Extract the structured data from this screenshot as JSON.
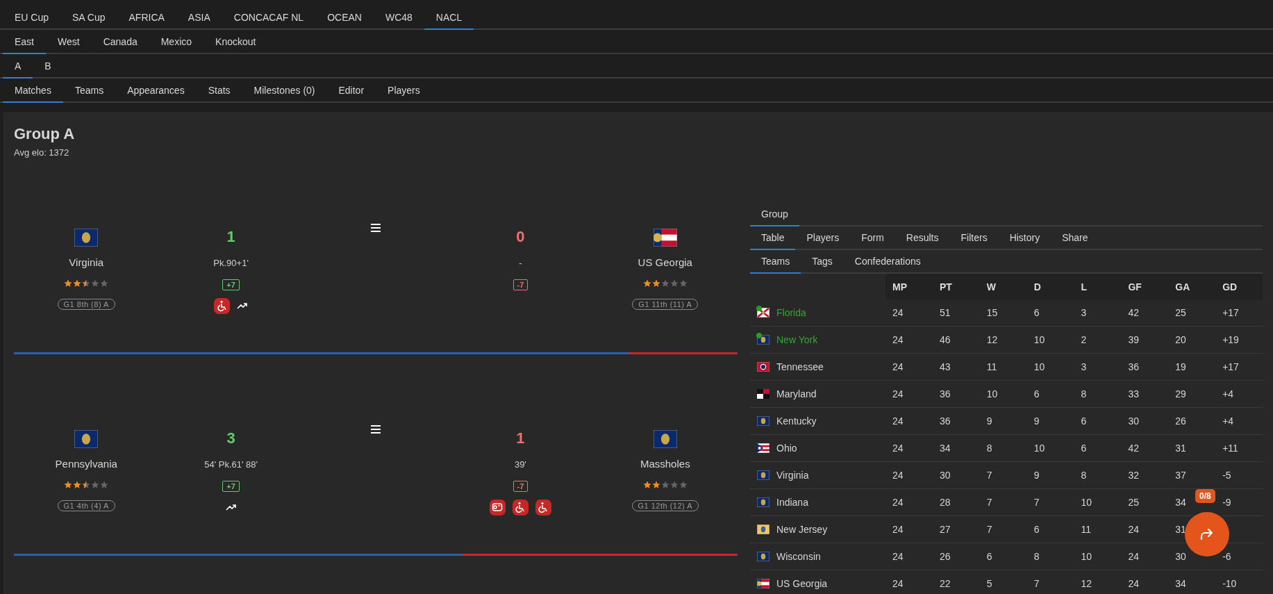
{
  "tab_bars": [
    [
      {
        "label": "EU Cup",
        "selected": false
      },
      {
        "label": "SA Cup",
        "selected": false
      },
      {
        "label": "AFRICA",
        "selected": false
      },
      {
        "label": "ASIA",
        "selected": false
      },
      {
        "label": "CONCACAF NL",
        "selected": false
      },
      {
        "label": "OCEAN",
        "selected": false
      },
      {
        "label": "WC48",
        "selected": false
      },
      {
        "label": "NACL",
        "selected": true
      }
    ],
    [
      {
        "label": "East",
        "selected": true
      },
      {
        "label": "West",
        "selected": false
      },
      {
        "label": "Canada",
        "selected": false
      },
      {
        "label": "Mexico",
        "selected": false
      },
      {
        "label": "Knockout",
        "selected": false
      }
    ],
    [
      {
        "label": "A",
        "selected": true
      },
      {
        "label": "B",
        "selected": false
      }
    ],
    [
      {
        "label": "Matches",
        "selected": true
      },
      {
        "label": "Teams",
        "selected": false
      },
      {
        "label": "Appearances",
        "selected": false
      },
      {
        "label": "Stats",
        "selected": false
      },
      {
        "label": "Milestones (0)",
        "selected": false
      },
      {
        "label": "Editor",
        "selected": false
      },
      {
        "label": "Players",
        "selected": false
      }
    ]
  ],
  "group": {
    "title": "Group A",
    "subtitle": "Avg elo: 1372"
  },
  "matches": [
    {
      "level": 0.85,
      "home": {
        "name": "Virginia",
        "flag": {
          "kind": "blue-seal"
        },
        "score": "1",
        "winner": true,
        "scorers": "Pk.90+1'",
        "stars": 2.5,
        "change": "+7",
        "tag": "G1 8th (8) A",
        "icons": [
          {
            "kind": "wheelchair"
          },
          {
            "kind": "trend"
          }
        ]
      },
      "away": {
        "name": "US Georgia",
        "flag": {
          "kind": "georgia"
        },
        "score": "0",
        "winner": false,
        "scorers": "-",
        "stars": 2,
        "change": "-7",
        "tag": "G1 11th (11) A"
      }
    },
    {
      "level": 0.62,
      "home": {
        "name": "Pennsylvania",
        "flag": {
          "kind": "blue-seal"
        },
        "score": "3",
        "winner": true,
        "scorers": "54' Pk.61' 88'",
        "stars": 2.5,
        "change": "+7",
        "tag": "G1 4th (4) A",
        "icons": [
          {
            "kind": "trend"
          }
        ]
      },
      "away": {
        "name": "Massholes",
        "flag": {
          "kind": "blue-seal"
        },
        "score": "1",
        "winner": false,
        "scorers": "39'",
        "stars": 2,
        "change": "-7",
        "tag": "G1 12th (12) A",
        "icons": [
          {
            "kind": "roll"
          },
          {
            "kind": "wheelchair"
          },
          {
            "kind": "wheelchair"
          }
        ]
      }
    }
  ],
  "side_panel": {
    "tab_bars": [
      [
        {
          "label": "Group",
          "selected": true
        }
      ],
      [
        {
          "label": "Table",
          "selected": true
        },
        {
          "label": "Players",
          "selected": false
        },
        {
          "label": "Form",
          "selected": false
        },
        {
          "label": "Results",
          "selected": false
        },
        {
          "label": "Filters",
          "selected": false
        },
        {
          "label": "History",
          "selected": false
        },
        {
          "label": "Share",
          "selected": false
        }
      ],
      [
        {
          "label": "Teams",
          "selected": true
        },
        {
          "label": "Tags",
          "selected": false
        },
        {
          "label": "Confederations",
          "selected": false
        }
      ]
    ],
    "table": {
      "columns": [
        "MP",
        "PT",
        "W",
        "D",
        "L",
        "GF",
        "GA",
        "GD"
      ],
      "rows": [
        {
          "team": "Florida",
          "flag": {
            "kind": "florida"
          },
          "qualified": true,
          "cells": [
            "24",
            "51",
            "15",
            "6",
            "3",
            "42",
            "25",
            "+17"
          ]
        },
        {
          "team": "New York",
          "flag": {
            "kind": "blue-seal"
          },
          "qualified": true,
          "cells": [
            "24",
            "46",
            "12",
            "10",
            "2",
            "39",
            "20",
            "+19"
          ]
        },
        {
          "team": "Tennessee",
          "flag": {
            "kind": "tennessee"
          },
          "qualified": false,
          "cells": [
            "24",
            "43",
            "11",
            "10",
            "3",
            "36",
            "19",
            "+17"
          ]
        },
        {
          "team": "Maryland",
          "flag": {
            "kind": "maryland"
          },
          "qualified": false,
          "cells": [
            "24",
            "36",
            "10",
            "6",
            "8",
            "33",
            "29",
            "+4"
          ]
        },
        {
          "team": "Kentucky",
          "flag": {
            "kind": "blue-seal"
          },
          "qualified": false,
          "cells": [
            "24",
            "36",
            "9",
            "9",
            "6",
            "30",
            "26",
            "+4"
          ]
        },
        {
          "team": "Ohio",
          "flag": {
            "kind": "ohio"
          },
          "qualified": false,
          "cells": [
            "24",
            "34",
            "8",
            "10",
            "6",
            "42",
            "31",
            "+11"
          ]
        },
        {
          "team": "Virginia",
          "flag": {
            "kind": "blue-seal"
          },
          "qualified": false,
          "cells": [
            "24",
            "30",
            "7",
            "9",
            "8",
            "32",
            "37",
            "-5"
          ]
        },
        {
          "team": "Indiana",
          "flag": {
            "kind": "blue-seal"
          },
          "qualified": false,
          "cells": [
            "24",
            "28",
            "7",
            "7",
            "10",
            "25",
            "34",
            "-9"
          ]
        },
        {
          "team": "New Jersey",
          "flag": {
            "kind": "new-jersey"
          },
          "qualified": false,
          "cells": [
            "24",
            "27",
            "7",
            "6",
            "11",
            "24",
            "31"
          ]
        },
        {
          "team": "Wisconsin",
          "flag": {
            "kind": "blue-seal"
          },
          "qualified": false,
          "cells": [
            "24",
            "26",
            "6",
            "8",
            "10",
            "24",
            "30",
            "-6"
          ]
        },
        {
          "team": "US Georgia",
          "flag": {
            "kind": "georgia"
          },
          "qualified": false,
          "cells": [
            "24",
            "22",
            "5",
            "7",
            "12",
            "24",
            "34",
            "-10"
          ]
        }
      ]
    }
  },
  "share_button": {
    "badge": "0/8"
  }
}
